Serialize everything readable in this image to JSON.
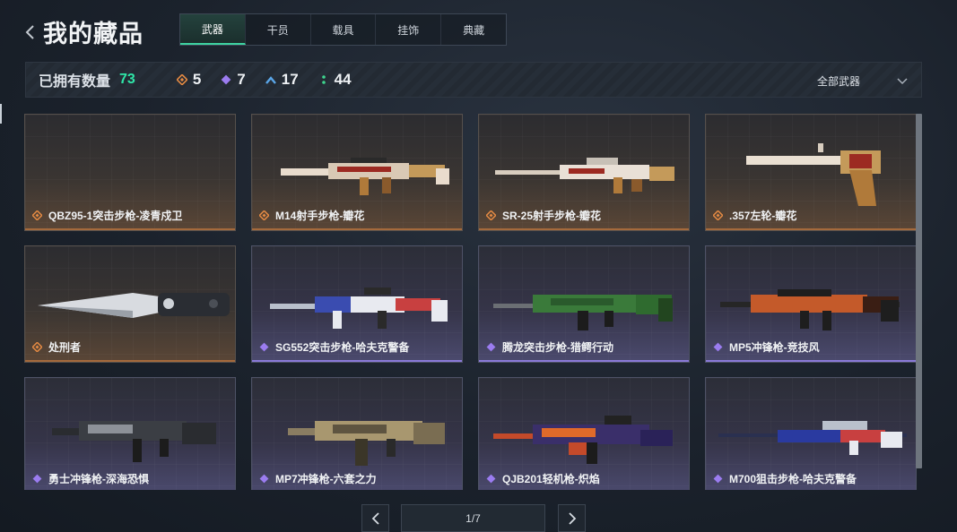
{
  "header": {
    "title": "我的藏品",
    "tabs": [
      {
        "label": "武器",
        "active": true
      },
      {
        "label": "干员",
        "active": false
      },
      {
        "label": "载具",
        "active": false
      },
      {
        "label": "挂饰",
        "active": false
      },
      {
        "label": "典藏",
        "active": false
      }
    ]
  },
  "stats": {
    "owned_label": "已拥有数量",
    "owned_count": "73",
    "rarity_counts": [
      {
        "icon": "orange-diamond-icon",
        "value": "5",
        "color": "#e58a43"
      },
      {
        "icon": "purple-diamond-icon",
        "value": "7",
        "color": "#9b7cf0"
      },
      {
        "icon": "blue-chevron-icon",
        "value": "17",
        "color": "#5aa6e8"
      },
      {
        "icon": "green-dots-icon",
        "value": "44",
        "color": "#3ed48e"
      }
    ],
    "filter_label": "全部武器"
  },
  "items": [
    {
      "name": "QBZ95-1突击步枪-凌青戍卫",
      "rarity": "orange",
      "gun": "none"
    },
    {
      "name": "M14射手步枪-瓣花",
      "rarity": "orange",
      "gun": "rifle-gold"
    },
    {
      "name": "SR-25射手步枪-瓣花",
      "rarity": "orange",
      "gun": "sniper-gold"
    },
    {
      "name": ".357左轮-瓣花",
      "rarity": "orange",
      "gun": "revolver-gold"
    },
    {
      "name": "处刑者",
      "rarity": "orange",
      "gun": "knife"
    },
    {
      "name": "SG552突击步枪-哈夫克警备",
      "rarity": "purple",
      "gun": "rifle-blue"
    },
    {
      "name": "腾龙突击步枪-猎鳄行动",
      "rarity": "purple",
      "gun": "rifle-green"
    },
    {
      "name": "MP5冲锋枪-竞技风",
      "rarity": "purple",
      "gun": "smg-orange"
    },
    {
      "name": "勇士冲锋枪-深海恐惧",
      "rarity": "purple",
      "gun": "smg-dark"
    },
    {
      "name": "MP7冲锋枪-六套之力",
      "rarity": "purple",
      "gun": "smg-tan"
    },
    {
      "name": "QJB201轻机枪-炽焰",
      "rarity": "purple",
      "gun": "lmg-fire"
    },
    {
      "name": "M700狙击步枪-哈夫克警备",
      "rarity": "purple",
      "gun": "sniper-blue"
    }
  ],
  "pagination": {
    "label": "1/7"
  },
  "colors": {
    "accent": "#2fe6a8",
    "orange": "#e58a43",
    "purple": "#9b7cf0"
  }
}
